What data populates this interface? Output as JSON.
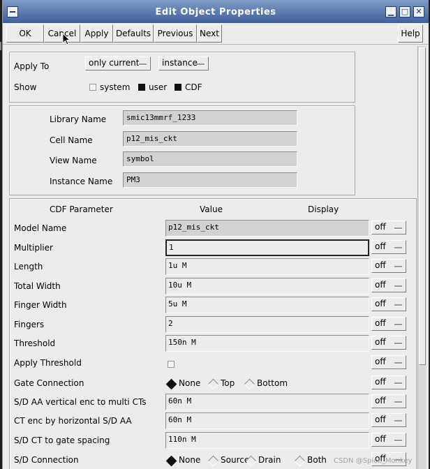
{
  "window": {
    "title": "Edit Object Properties"
  },
  "toolbar": {
    "ok": "OK",
    "cancel": "Cancel",
    "apply": "Apply",
    "defaults": "Defaults",
    "previous": "Previous",
    "next": "Next",
    "help": "Help"
  },
  "apply_section": {
    "apply_to_label": "Apply To",
    "apply_to_value": "only current",
    "apply_to_target": "instance",
    "show_label": "Show",
    "show_options": [
      {
        "label": "system",
        "checked": false
      },
      {
        "label": "user",
        "checked": true
      },
      {
        "label": "CDF",
        "checked": true
      }
    ]
  },
  "identity": {
    "library_label": "Library Name",
    "library_value": "smic13mmrf_1233",
    "cell_label": "Cell Name",
    "cell_value": "p12_mis_ckt",
    "view_label": "View Name",
    "view_value": "symbol",
    "instance_label": "Instance Name",
    "instance_value": "PM3"
  },
  "cdf": {
    "headers": {
      "param": "CDF Parameter",
      "value": "Value",
      "display": "Display"
    },
    "display_value": "off",
    "rows": [
      {
        "label": "Model Name",
        "value": "p12_mis_ckt"
      },
      {
        "label": "Multiplier",
        "value": "1"
      },
      {
        "label": "Length",
        "value": "1u M"
      },
      {
        "label": "Total Width",
        "value": "10u M"
      },
      {
        "label": "Finger Width",
        "value": "5u M"
      },
      {
        "label": "Fingers",
        "value": "2"
      },
      {
        "label": "Threshold",
        "value": "150n M"
      },
      {
        "label": "Apply Threshold",
        "checked": false
      },
      {
        "label": "Gate Connection",
        "options": [
          "None",
          "Top",
          "Bottom"
        ],
        "selected": "None"
      },
      {
        "label": "S/D AA vertical enc to multi CTs",
        "value": "60n M"
      },
      {
        "label": "CT enc by horizontal S/D AA",
        "value": "60n M"
      },
      {
        "label": "S/D CT to gate spacing",
        "value": "110n M"
      },
      {
        "label": "S/D Connection",
        "options": [
          "None",
          "Source",
          "Drain",
          "Both"
        ],
        "selected": "None"
      }
    ]
  },
  "watermark": "CSDN @Spice_Monkey"
}
